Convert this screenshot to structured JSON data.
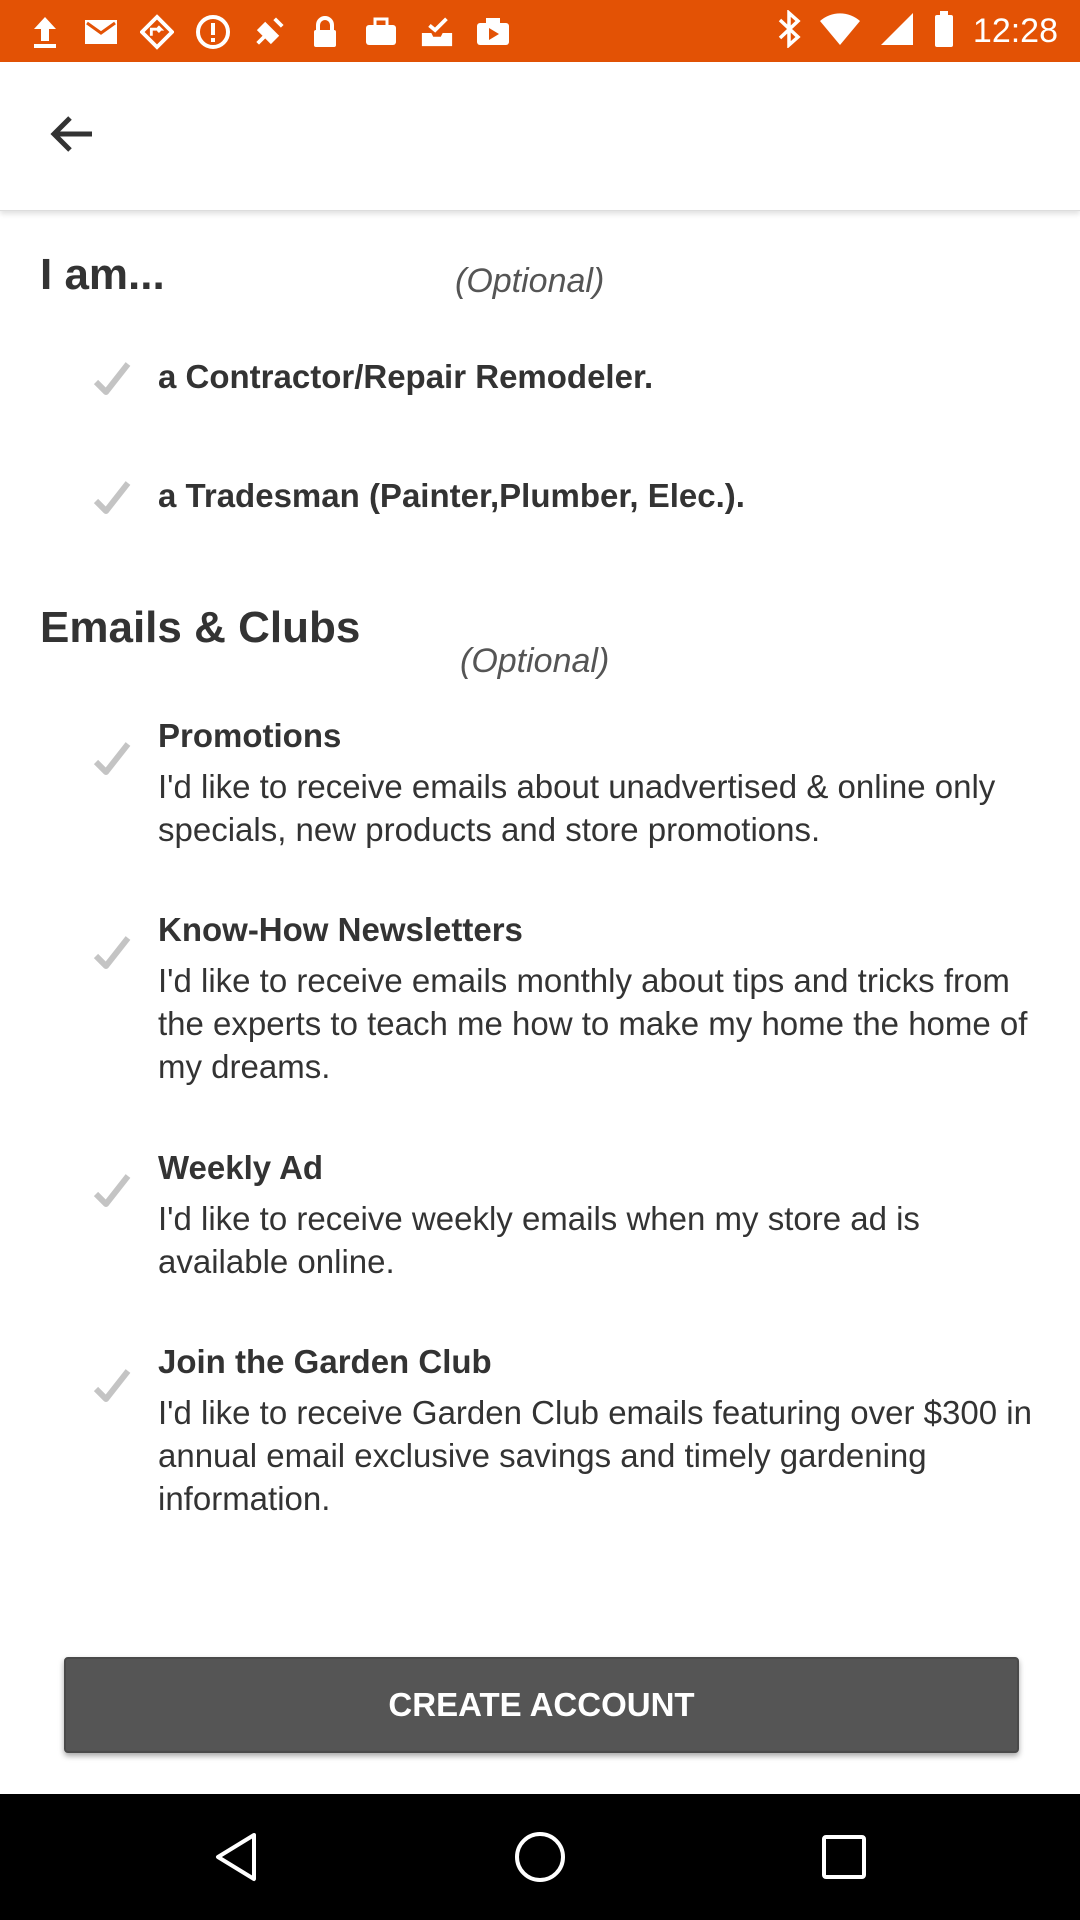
{
  "status_bar": {
    "time": "12:28",
    "left_icons": [
      "upload-icon",
      "mail-icon",
      "diamond-nav-icon",
      "alert-icon",
      "fake-gps-icon",
      "lock-icon",
      "briefcase-icon",
      "inbox-check-icon",
      "video-play-icon"
    ],
    "right_icons": [
      "bluetooth-icon",
      "wifi-icon",
      "signal-icon",
      "battery-icon"
    ],
    "background": "#e35205"
  },
  "app_bar": {
    "back_icon": "arrow-back-icon"
  },
  "role_section": {
    "title": "I am...",
    "optional": "(Optional)",
    "options": [
      {
        "label": "a Contractor/Repair Remodeler."
      },
      {
        "label": "a Tradesman (Painter,Plumber, Elec.)."
      }
    ]
  },
  "emails_section": {
    "title": "Emails & Clubs",
    "optional": "(Optional)",
    "options": [
      {
        "label": "Promotions",
        "description": "I'd like to receive emails about unadvertised & online only specials, new products and store promotions."
      },
      {
        "label": "Know-How Newsletters",
        "description": "I'd like to receive emails monthly about tips and tricks from the experts to teach me how to make my home the home of my dreams."
      },
      {
        "label": "Weekly Ad",
        "description": "I'd like to receive weekly emails when my store ad is available online."
      },
      {
        "label": "Join the Garden Club",
        "description": "I'd like to receive Garden Club emails featuring over $300 in annual email exclusive savings and timely gardening information."
      }
    ]
  },
  "create_button": {
    "label": "CREATE ACCOUNT",
    "color": "#555555"
  },
  "nav_bar": {
    "icons": [
      "back-triangle-icon",
      "home-circle-icon",
      "recents-square-icon"
    ]
  }
}
